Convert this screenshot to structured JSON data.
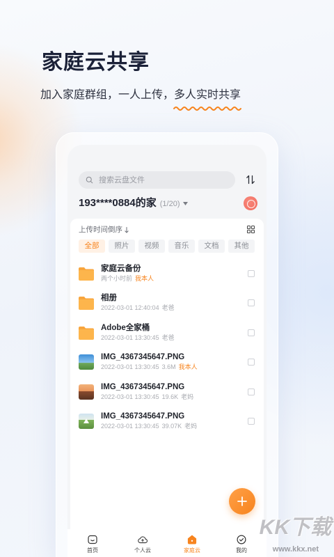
{
  "headline": {
    "title": "家庭云共享",
    "subtitle_lead": "加入家庭群组，一人上传，",
    "subtitle_highlight": "多人实时共享"
  },
  "colors": {
    "accent": "#f7841e",
    "title": "#1b2138",
    "folder": "#fdb54c",
    "folder_tab": "#f8a53c",
    "avatar": "#f26b5e"
  },
  "app": {
    "search": {
      "placeholder": "搜索云盘文件",
      "icon": "search-icon"
    },
    "sort_toggle_icon": "sort-icon",
    "family": {
      "name": "193****0884的家",
      "member_count": "(1/20)",
      "dropdown_icon": "chevron-down-icon",
      "avatar_icon": "family-avatar-icon"
    },
    "sort": {
      "label": "上传时间倒序",
      "direction_icon": "arrow-down-icon"
    },
    "view_icon": "grid-view-icon",
    "tabs": [
      {
        "label": "全部",
        "active": true
      },
      {
        "label": "照片",
        "active": false
      },
      {
        "label": "视频",
        "active": false
      },
      {
        "label": "音乐",
        "active": false
      },
      {
        "label": "文档",
        "active": false
      },
      {
        "label": "其他",
        "active": false
      }
    ],
    "files": [
      {
        "icon": "folder-icon",
        "name": "家庭云备份",
        "time": "两个小时前",
        "owner": "我本人",
        "owner_is_self": true
      },
      {
        "icon": "folder-icon",
        "name": "相册",
        "time": "2022-03-01 12:40:04",
        "owner": "老爸",
        "owner_is_self": false
      },
      {
        "icon": "folder-icon",
        "name": "Adobe全家桶",
        "time": "2022-03-01 13:30:45",
        "owner": "老爸",
        "owner_is_self": false
      },
      {
        "icon": "image-thumbnail-sky",
        "name": "IMG_4367345647.PNG",
        "time": "2022-03-01 13:30:45",
        "size": "3.6M",
        "owner": "我本人",
        "owner_is_self": true
      },
      {
        "icon": "image-thumbnail-sunset",
        "name": "IMG_4367345647.PNG",
        "time": "2022-03-01 13:30:45",
        "size": "19.6K",
        "owner": "老妈",
        "owner_is_self": false
      },
      {
        "icon": "image-thumbnail-meadow",
        "name": "IMG_4367345647.PNG",
        "time": "2022-03-01 13:30:45",
        "size": "39.07K",
        "owner": "老妈",
        "owner_is_self": false
      }
    ],
    "fab_icon": "plus-icon",
    "nav": [
      {
        "label": "首页",
        "icon": "home-icon",
        "active": false
      },
      {
        "label": "个人云",
        "icon": "personal-cloud-icon",
        "active": false
      },
      {
        "label": "家庭云",
        "icon": "family-cloud-icon",
        "active": true
      },
      {
        "label": "我的",
        "icon": "profile-icon",
        "active": false
      }
    ]
  },
  "watermark": {
    "logo": "KK下载",
    "url": "www.kkx.net"
  }
}
